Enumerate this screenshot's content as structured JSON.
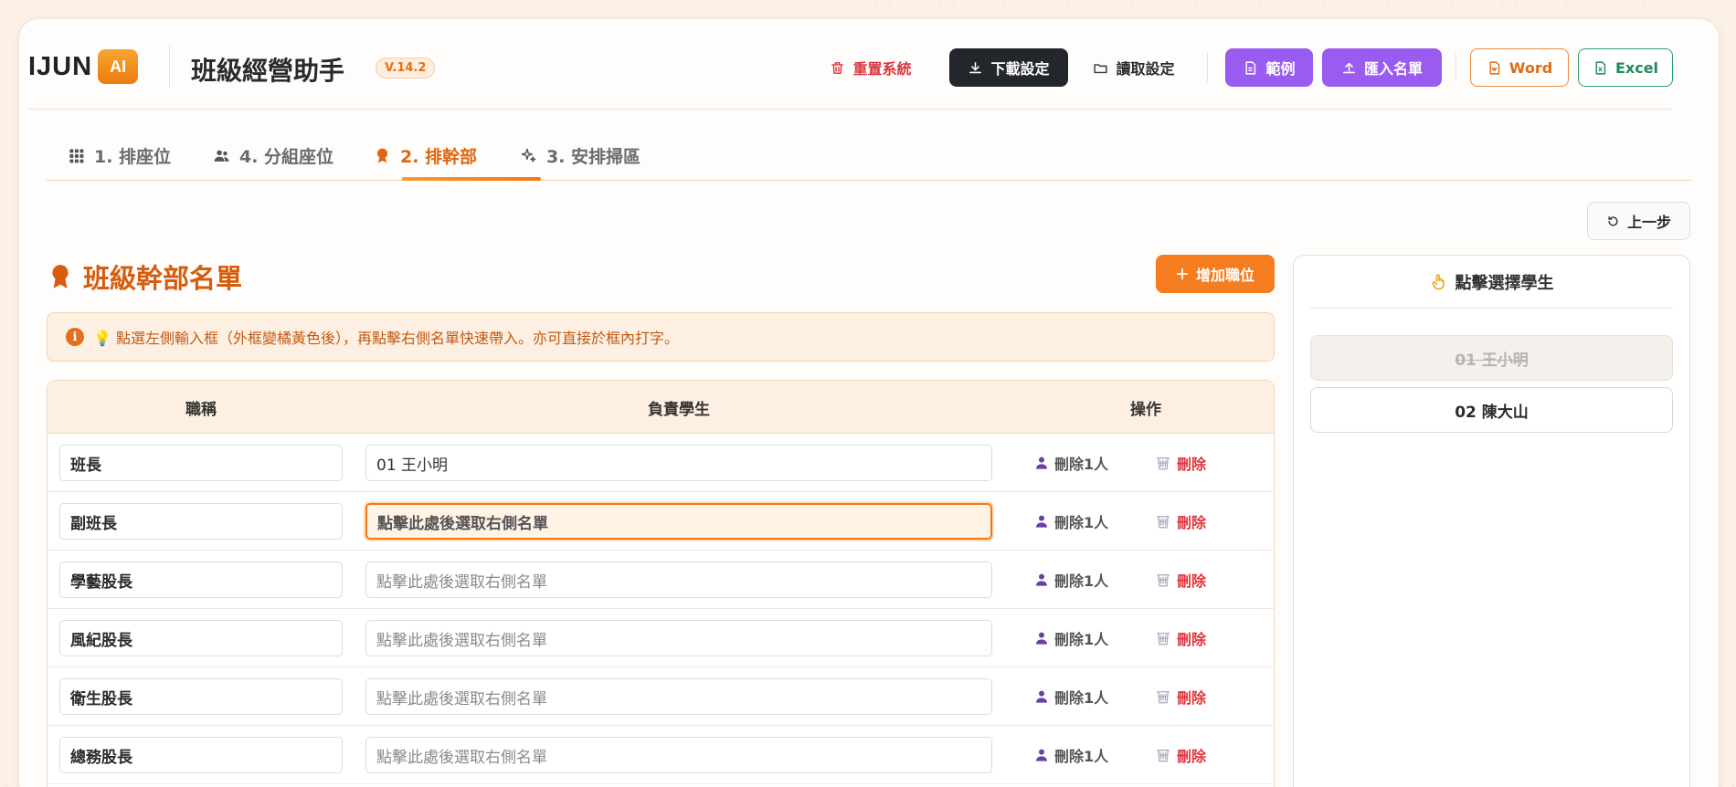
{
  "header": {
    "logo_text": "IJUN",
    "logo_badge": "AI",
    "app_title": "班級經營助手",
    "version": "V.14.2",
    "buttons": {
      "reset": "重置系統",
      "download": "下載設定",
      "read": "讀取設定",
      "sample": "範例",
      "import": "匯入名單",
      "word": "Word",
      "excel": "Excel"
    }
  },
  "tabs": [
    {
      "label": "1. 排座位",
      "icon": "grid-icon"
    },
    {
      "label": "4. 分組座位",
      "icon": "users-icon"
    },
    {
      "label": "2. 排幹部",
      "icon": "award-icon",
      "active": true
    },
    {
      "label": "3. 安排掃區",
      "icon": "sparkles-icon"
    }
  ],
  "undo_label": "上一步",
  "section": {
    "title": "班級幹部名單",
    "add_label": "增加職位",
    "notice": "💡 點選左側輸入框（外框變橘黃色後），再點擊右側名單快速帶入。亦可直接於框內打字。"
  },
  "table": {
    "headers": [
      "職稱",
      "負責學生",
      "操作"
    ],
    "placeholder": "點擊此處後選取右側名單",
    "remove_one_label": "刪除1人",
    "delete_label": "刪除",
    "rows": [
      {
        "title": "班長",
        "student": "01 王小明"
      },
      {
        "title": "副班長",
        "student": ""
      },
      {
        "title": "學藝股長",
        "student": ""
      },
      {
        "title": "風紀股長",
        "student": ""
      },
      {
        "title": "衛生股長",
        "student": ""
      },
      {
        "title": "總務股長",
        "student": ""
      }
    ]
  },
  "side": {
    "title": "點擊選擇學生",
    "students": [
      {
        "label": "01 王小明",
        "used": true
      },
      {
        "label": "02 陳大山",
        "used": false
      }
    ]
  },
  "colors": {
    "accent": "#f57c1f",
    "purple": "#9a5cf0",
    "danger": "#e0343c",
    "excel": "#1f8a5c"
  }
}
